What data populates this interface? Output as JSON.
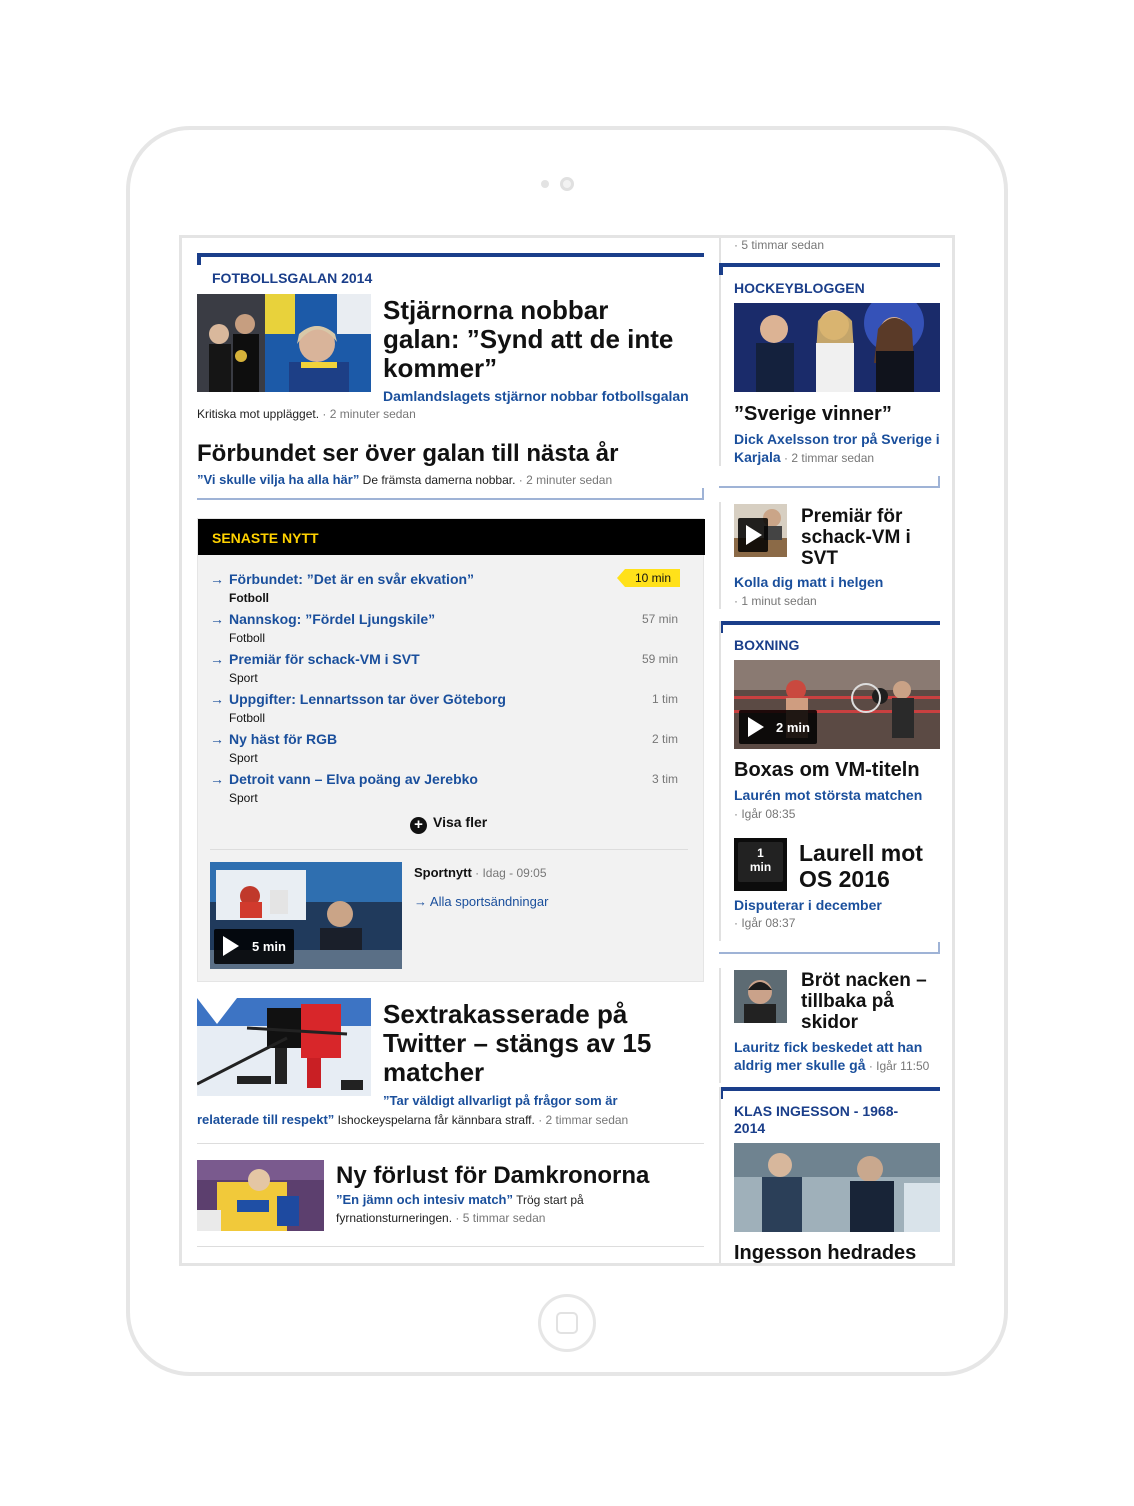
{
  "top_section": {
    "kicker": "FOTBOLLSGALAN 2014",
    "headline_lines": [
      "Stjärnorna nobbar",
      "galan: ”Synd att de inte",
      "kommer”"
    ],
    "sub_link": "Damlandslagets stjärnor nobbar fotbollsgalan",
    "intro": "Kritiska mot upplägget.",
    "time": " · 2 minuter sedan",
    "second_headline": "Förbundet ser över galan till nästa år",
    "second_quote": "”Vi skulle vilja ha alla här”",
    "second_text": " De främsta damerna nobbar.",
    "second_time": " · 2 minuter sedan"
  },
  "senaste_nytt": {
    "header": "SENASTE NYTT",
    "items": [
      {
        "arrow": "→",
        "title": "Förbundet: ”Det är en svår ekvation”",
        "category": "Fotboll",
        "time": "10 min"
      },
      {
        "arrow": "→",
        "title": "Nannskog: ”Fördel Ljungskile”",
        "category": "Fotboll",
        "time": "57 min"
      },
      {
        "arrow": "→",
        "title": "Premiär för schack-VM i SVT",
        "category": "Sport",
        "time": "59 min"
      },
      {
        "arrow": "→",
        "title": "Uppgifter: Lennartsson tar över Göteborg",
        "category": "Fotboll",
        "time": "1 tim"
      },
      {
        "arrow": "→",
        "title": "Ny häst för RGB",
        "category": "Sport",
        "time": "2 tim"
      },
      {
        "arrow": "→",
        "title": "Detroit vann – Elva poäng av Jerebko",
        "category": "Sport",
        "time": "3 tim"
      }
    ],
    "show_more": "Visa fler",
    "plus_icon": "+",
    "video": {
      "duration": "5 min",
      "program": "Sportnytt",
      "program_time": " · Idag - 09:05",
      "all_link_arrow": "→",
      "all_link": "Alla sportsändningar"
    }
  },
  "article_hockey": {
    "headline_lines": [
      "Sextrakasserade på",
      "Twitter – stängs av 15",
      "matcher"
    ],
    "quote_line1": "”Tar väldigt allvarligt på frågor som är",
    "quote_line2": "relaterade till respekt”",
    "text": " Ishockeyspelarna får kännbara straff.",
    "time": " · 2 timmar sedan"
  },
  "article_dam": {
    "headline": "Ny förlust för Damkronorna",
    "quote": "”En jämn och intesiv match”",
    "text1": " Trög start på",
    "text2": "fyrnationsturneringen.",
    "time": " · 5 timmar sedan"
  },
  "sidebar": {
    "top_meta": "· 5 timmar sedan",
    "hockeybloggen": {
      "kicker": "HOCKEYBLOGGEN",
      "headline": "”Sverige vinner”",
      "link_line1": "Dick Axelsson tror på Sverige i",
      "link_line2": "Karjala",
      "time": " · 2 timmar sedan"
    },
    "schack": {
      "headline_lines": [
        "Premiär för",
        "schack-VM i",
        "SVT"
      ],
      "link": "Kolla dig matt i helgen",
      "time": "· 1 minut sedan"
    },
    "boxning": {
      "kicker": "BOXNING",
      "duration": "2 min",
      "headline": "Boxas om VM-titeln",
      "link": "Laurén mot största matchen",
      "time": "· Igår 08:35"
    },
    "laurell": {
      "badge_line1": "1",
      "badge_line2": "min",
      "headline_lines": [
        "Laurell mot",
        "OS 2016"
      ],
      "link": "Disputerar i december",
      "time": "· Igår 08:37"
    },
    "brot": {
      "headline_lines": [
        "Bröt nacken –",
        "tillbaka på",
        "skidor"
      ],
      "link_line1": "Lauritz fick beskedet att han",
      "link_line2": "aldrig mer skulle gå",
      "time": " · Igår 11:50"
    },
    "ingesson": {
      "kicker_line1": "KLAS INGESSON - 1968-",
      "kicker_line2": "2014",
      "headline": "Ingesson hedrades"
    }
  },
  "colors": {
    "accent_blue": "#1a3e8a",
    "link_blue": "#1a4f9c",
    "highlight_yellow": "#ffe11a",
    "header_yellow": "#ffd200"
  }
}
